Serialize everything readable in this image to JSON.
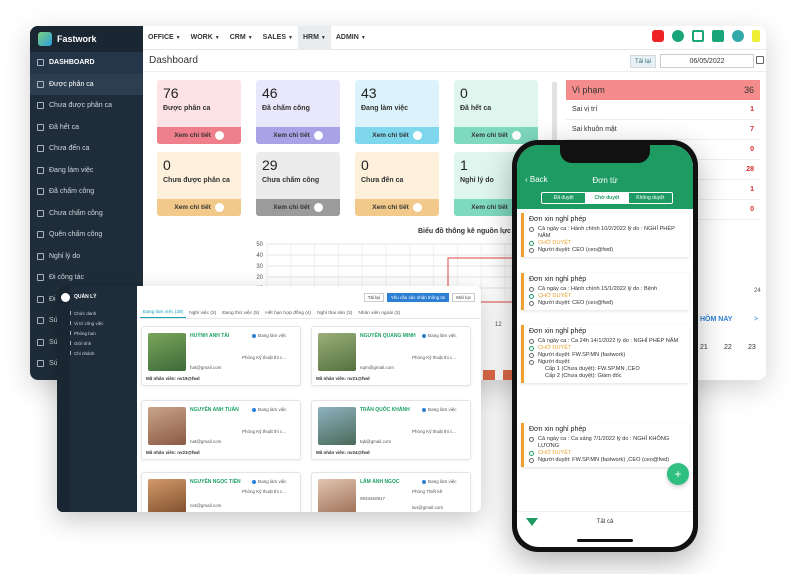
{
  "app": {
    "name": "Fastwork"
  },
  "sidebar": {
    "items": [
      {
        "label": "DASHBOARD"
      },
      {
        "label": "Được phân ca"
      },
      {
        "label": "Chưa được phân ca"
      },
      {
        "label": "Đã hết ca"
      },
      {
        "label": "Chưa đến ca"
      },
      {
        "label": "Đang làm việc"
      },
      {
        "label": "Đã chấm công"
      },
      {
        "label": "Chưa chấm công"
      },
      {
        "label": "Quên chấm công"
      },
      {
        "label": "Nghỉ lý do"
      },
      {
        "label": "Đi công tác"
      },
      {
        "label": "Đi"
      },
      {
        "label": "Sứ"
      },
      {
        "label": "Sứ"
      },
      {
        "label": "Sứ"
      }
    ]
  },
  "topmenu": [
    "OFFICE",
    "WORK",
    "CRM",
    "SALES",
    "HRM",
    "ADMIN"
  ],
  "colors": {
    "sidebar": "#1f2d3a",
    "brand_green": "#1e9b63",
    "violation": "#f48c8c"
  },
  "page": {
    "title": "Dashboard",
    "reload": "Tải lại",
    "date": "06/05/2022"
  },
  "stats": [
    {
      "num": "76",
      "label": "Được phân ca",
      "btn": "Xem chi tiết"
    },
    {
      "num": "46",
      "label": "Đã chấm công",
      "btn": "Xem chi tiết"
    },
    {
      "num": "43",
      "label": "Đang làm việc",
      "btn": "Xem chi tiết"
    },
    {
      "num": "0",
      "label": "Đã hết ca",
      "btn": "Xem chi tiết"
    },
    {
      "num": "0",
      "label": "Chưa được phân ca",
      "btn": "Xem chi tiết"
    },
    {
      "num": "29",
      "label": "Chưa chấm công",
      "btn": "Xem chi tiết"
    },
    {
      "num": "0",
      "label": "Chưa đến ca",
      "btn": "Xem chi tiết"
    },
    {
      "num": "1",
      "label": "Nghỉ lý do",
      "btn": "Xem chi tiết"
    }
  ],
  "violations": {
    "title": "Vi phạm",
    "total": "36",
    "rows": [
      {
        "label": "Sai vị trí",
        "value": "1"
      },
      {
        "label": "Sai khuôn mặt",
        "value": "7"
      },
      {
        "label": "",
        "value": "0"
      },
      {
        "label": "",
        "value": "28"
      },
      {
        "label": "",
        "value": "1"
      },
      {
        "label": "",
        "value": "0"
      }
    ]
  },
  "chart": {
    "title": "Biểu đồ thống kê nguồn lực",
    "y_ticks": [
      "50",
      "40",
      "30",
      "20",
      "10"
    ],
    "x_tail": [
      "12"
    ],
    "right_ticks": [
      "23",
      "24"
    ],
    "week_label": "HÔM NAY",
    "cal_days": [
      "21",
      "22",
      "23"
    ]
  },
  "hr": {
    "side_head": "QUẢN LÝ",
    "side_items": [
      "Chức danh",
      "Vị trí công việc",
      "Phòng ban",
      "Giới tính",
      "Chi nhánh"
    ],
    "toolbar": [
      "Tải lại",
      "Yêu cầu xác nhận thông tin",
      "Mới lọc"
    ],
    "tabs": [
      "Đang làm việc (38)",
      "Nghỉ việc (3)",
      "Đang thử việc (5)",
      "Hết hạn hợp đồng (4)",
      "Nghỉ thai sản (3)",
      "Nhân viên ngoài (3)"
    ],
    "employees": [
      {
        "name": "HUỲNH ANH TÀI",
        "status": "Đang làm việc",
        "dept": "Phòng Kỹ thuật thi c...",
        "email": "hat@gmail.com",
        "phone": "",
        "code": "Mã nhân viên: nv19@fwd"
      },
      {
        "name": "NGUYỄN QUANG MINH",
        "status": "Đang làm việc",
        "dept": "Phòng Kỹ thuật thi c...",
        "email": "nqm@gmail.com",
        "phone": "",
        "code": "Mã nhân viên: nv21@fwd"
      },
      {
        "name": "NGUYỄN ANH TUẤN",
        "status": "Đang làm việc",
        "dept": "Phòng Kỹ thuật thi c...",
        "email": "nat@gmail.com",
        "phone": "",
        "code": "Mã nhân viên: nv23@fwd"
      },
      {
        "name": "TRẦN QUỐC KHÁNH",
        "status": "Đang làm việc",
        "dept": "Phòng Kỹ thuật thi c...",
        "email": "tqk@gmail.com",
        "phone": "",
        "code": "Mã nhân viên: nv24@fwd"
      },
      {
        "name": "NGUYỄN NGỌC TIẾN",
        "status": "Đang làm việc",
        "dept": "Phòng Kỹ thuật thi c...",
        "email": "nnt@gmail.com",
        "phone": "",
        "code": ""
      },
      {
        "name": "LÂM ÁNH NGỌC",
        "status": "Đang làm việc",
        "dept": "Phòng Thiết kế",
        "email": "lan@gmail.com",
        "phone": "0933460917",
        "code": ""
      }
    ]
  },
  "phone": {
    "back": "Back",
    "title": "Đơn từ",
    "segments": [
      "Đã duyệt",
      "Chờ duyệt",
      "Không duyệt"
    ],
    "cards": [
      {
        "title": "Đơn xin nghỉ phép",
        "lines": [
          "Cả ngày ca : Hành chính 10/2/2022 lý do : NGHỈ PHÉP NĂM",
          "CHỜ DUYỆT",
          "Người duyệt: CEO (ceo@fwd)"
        ]
      },
      {
        "title": "Đơn xin nghỉ phép",
        "lines": [
          "Cả ngày ca : Hành chính 15/1/2022 lý do : Bệnh",
          "CHỜ DUYỆT",
          "Người duyệt: CEO (ceo@fwd)"
        ]
      },
      {
        "title": "Đơn xin nghỉ phép",
        "lines": [
          "Cả ngày ca : Ca 24h 14/1/2022 lý do : NGHỈ PHÉP NĂM",
          "CHỜ DUYỆT",
          "Người duyệt: FW.SP.MN (fastwork)",
          "Người duyệt:",
          "Cấp 1 (Chưa duyệt): FW.SP.MN ,CEO",
          "Cấp 2 (Chưa duyệt): Giám đốc"
        ]
      },
      {
        "title": "Đơn xin nghỉ phép",
        "lines": [
          "Cả ngày ca : Ca sáng 7/1/2022 lý do : NGHỈ KHÔNG LƯƠNG",
          "CHỜ DUYỆT",
          "Người duyệt: FW.SP.MN (fastwork) ,CEO (ceo@fwd)"
        ]
      }
    ],
    "bottom": "Tất cả",
    "fab": "+"
  }
}
